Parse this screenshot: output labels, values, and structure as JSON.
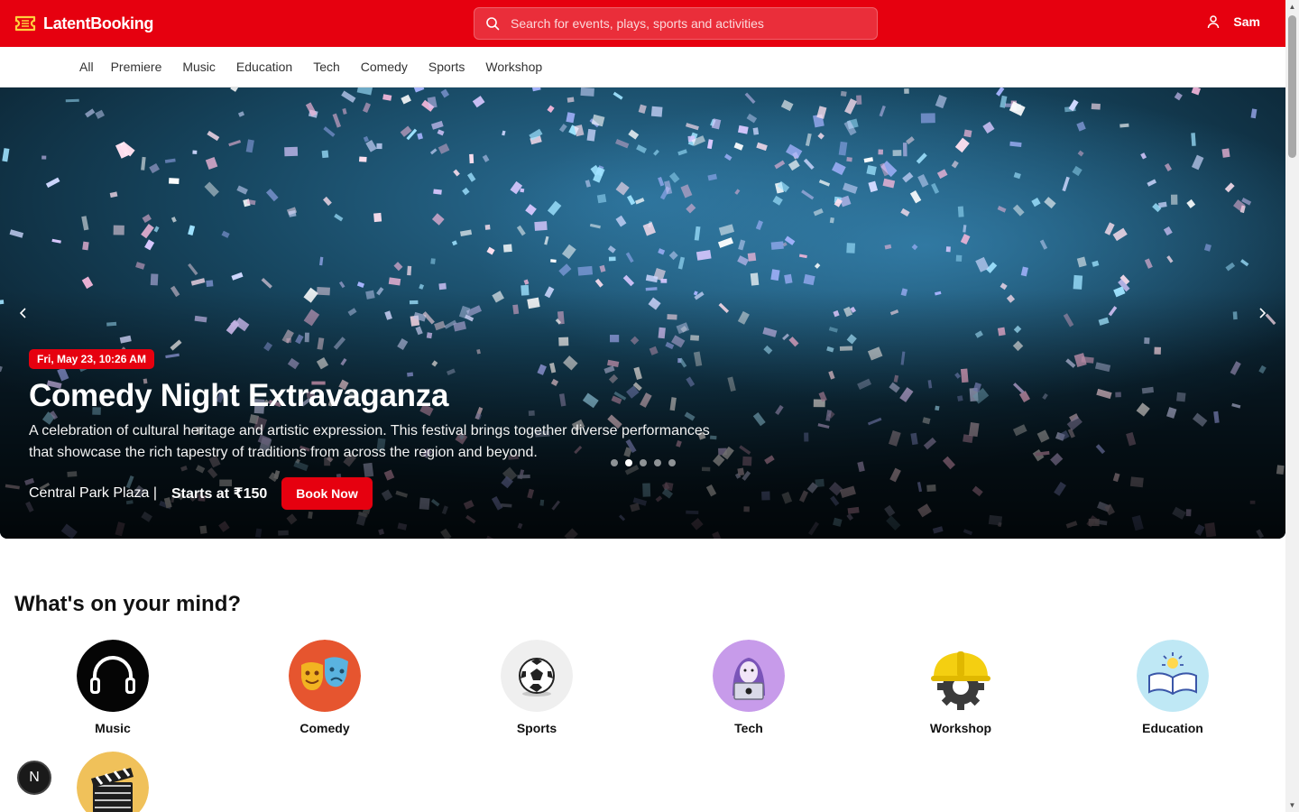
{
  "app": {
    "brand": "LatentBooking",
    "brand_color": "#e6000f"
  },
  "search": {
    "placeholder": "Search for events, plays, sports and activities"
  },
  "user": {
    "name": "Sam"
  },
  "nav": {
    "items": [
      "All",
      "Premiere",
      "Music",
      "Education",
      "Tech",
      "Comedy",
      "Sports",
      "Workshop"
    ]
  },
  "hero": {
    "date": "Fri, May 23, 10:26 AM",
    "title": "Comedy Night Extravaganza",
    "description": "A celebration of cultural heritage and artistic expression. This festival brings together diverse performances that showcase the rich tapestry of traditions from across the region and beyond.",
    "venue": "Central Park Plaza |",
    "price": "Starts at ₹150",
    "cta": "Book Now",
    "slide_count": 5,
    "active_slide": 2
  },
  "mind": {
    "title": "What's on your mind?",
    "categories": [
      {
        "label": "Music",
        "icon": "headphones-icon"
      },
      {
        "label": "Comedy",
        "icon": "theater-masks-icon"
      },
      {
        "label": "Sports",
        "icon": "soccer-ball-icon"
      },
      {
        "label": "Tech",
        "icon": "hacker-laptop-icon"
      },
      {
        "label": "Workshop",
        "icon": "hard-hat-gear-icon"
      },
      {
        "label": "Education",
        "icon": "open-book-icon"
      },
      {
        "label": "",
        "icon": "clapperboard-icon"
      }
    ]
  },
  "dev_badge": {
    "letter": "N"
  }
}
